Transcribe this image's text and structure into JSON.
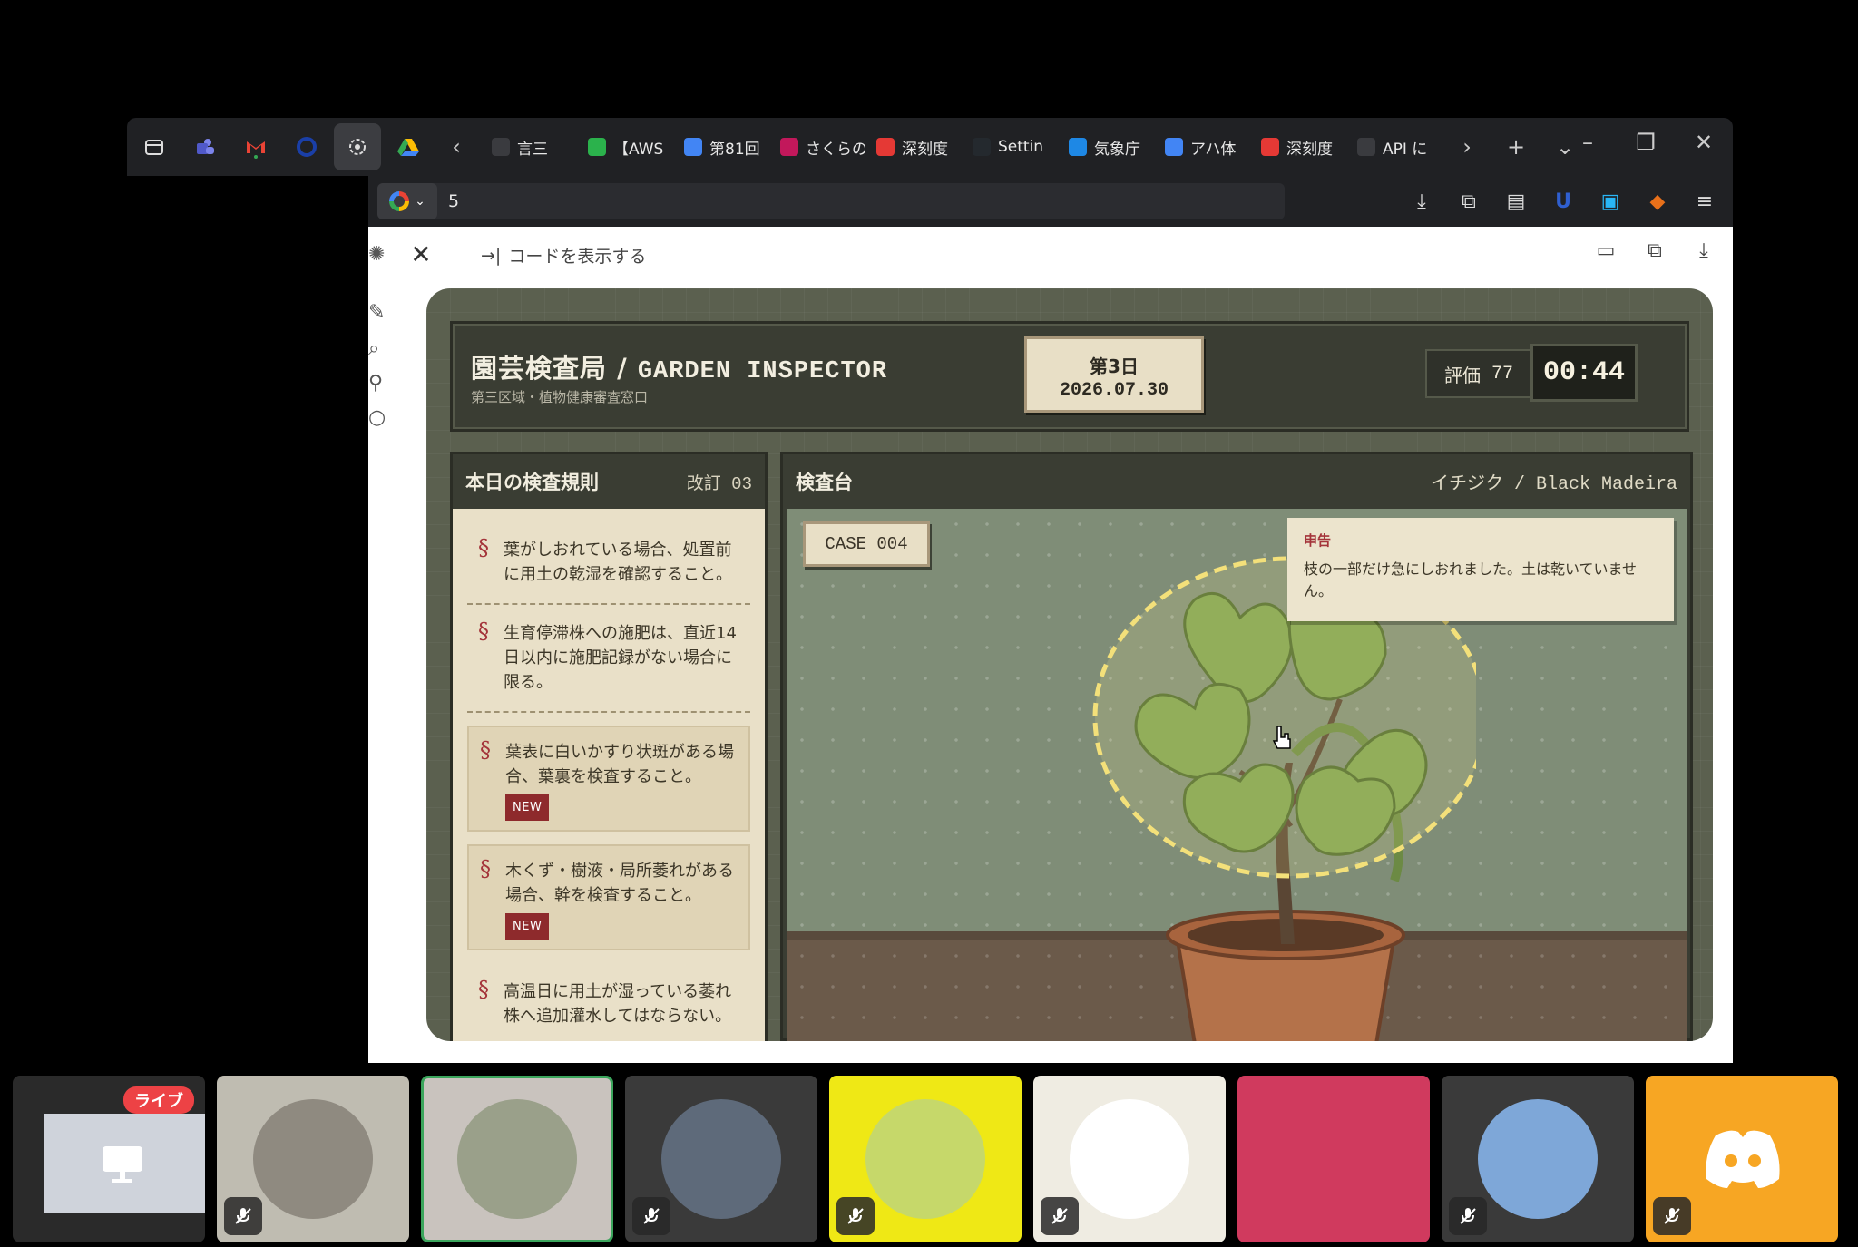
{
  "taskbar": {
    "pinned": [
      {
        "name": "tab-search-icon",
        "glyph": "▭"
      },
      {
        "name": "teams-icon",
        "glyph": "●"
      },
      {
        "name": "gmail-icon",
        "glyph": "M"
      },
      {
        "name": "circle-app-icon",
        "glyph": "◯"
      },
      {
        "name": "chatgpt-icon",
        "glyph": "✺"
      },
      {
        "name": "drive-icon",
        "glyph": "▲"
      }
    ],
    "tabs": [
      {
        "label": "言三",
        "icon": "doc-icon",
        "color": "#3a3b3f"
      },
      {
        "label": "【AWS",
        "icon": "green-app-icon",
        "color": "#2bb24c"
      },
      {
        "label": "第81回",
        "icon": "docs-icon",
        "color": "#4285f4"
      },
      {
        "label": "さくらの",
        "icon": "sakura-icon",
        "color": "#c2185b"
      },
      {
        "label": "深刻度",
        "icon": "red-f-icon",
        "color": "#e53935"
      },
      {
        "label": "Settin",
        "icon": "github-icon",
        "color": "#24292e"
      },
      {
        "label": "気象庁",
        "icon": "jma-icon",
        "color": "#1e88e5"
      },
      {
        "label": "アハ体",
        "icon": "google-icon",
        "color": "#4285f4"
      },
      {
        "label": "深刻度",
        "icon": "red-f-icon",
        "color": "#e53935"
      },
      {
        "label": "API に",
        "icon": "openai-icon",
        "color": "#3a3b3f"
      }
    ]
  },
  "address": {
    "url": "5"
  },
  "viewer": {
    "show_code": "コードを表示する"
  },
  "game": {
    "title_ja": "園芸検査局",
    "title_sep": " / ",
    "title_en": "GARDEN INSPECTOR",
    "subtitle": "第三区域・植物健康審査窓口",
    "day_label": "第3日",
    "date": "2026.07.30",
    "score_label": "評価",
    "score_value": "77",
    "timer": "00:44",
    "rules_panel": {
      "title": "本日の検査規則",
      "revision": "改訂 03",
      "rules": [
        {
          "text": "葉がしおれている場合、処置前に用土の乾湿を確認すること。",
          "is_new": false
        },
        {
          "text": "生育停滞株への施肥は、直近14日以内に施肥記録がない場合に限る。",
          "is_new": false
        },
        {
          "text": "葉表に白いかすり状斑がある場合、葉裏を検査すること。",
          "is_new": true
        },
        {
          "text": "木くず・樹液・局所萎れがある場合、幹を検査すること。",
          "is_new": true
        },
        {
          "text": "高温日に用土が湿っている萎れ株へ追加灌水してはならない。",
          "is_new": false
        }
      ],
      "new_tag": "NEW"
    },
    "table_panel": {
      "title": "検査台",
      "plant": "イチジク / Black Madeira",
      "case": "CASE 004",
      "report_label": "申告",
      "report_text": "枝の一部だけ急にしおれました。土は乾いていません。"
    }
  },
  "call_tiles": [
    {
      "name": "screen-share-tile",
      "bg": "#2a2a2a",
      "live": "ライブ"
    },
    {
      "name": "hamster-tile",
      "bg": "#bfbcb1"
    },
    {
      "name": "shiba-tile",
      "bg": "#c9c3be"
    },
    {
      "name": "train-tile",
      "bg": "#3a3a3a"
    },
    {
      "name": "cat-book-tile",
      "bg": "#efe815"
    },
    {
      "name": "smiling-man-tile",
      "bg": "#efece2"
    },
    {
      "name": "pink-tile",
      "bg": "#d03a5e"
    },
    {
      "name": "person-cap-tile",
      "bg": "#3a3a3a"
    },
    {
      "name": "discord-tile",
      "bg": "#f7a623"
    }
  ],
  "colors": {
    "accent_red": "#a4343a",
    "paper": "#e9e0c8",
    "panel": "#3a3d33"
  }
}
